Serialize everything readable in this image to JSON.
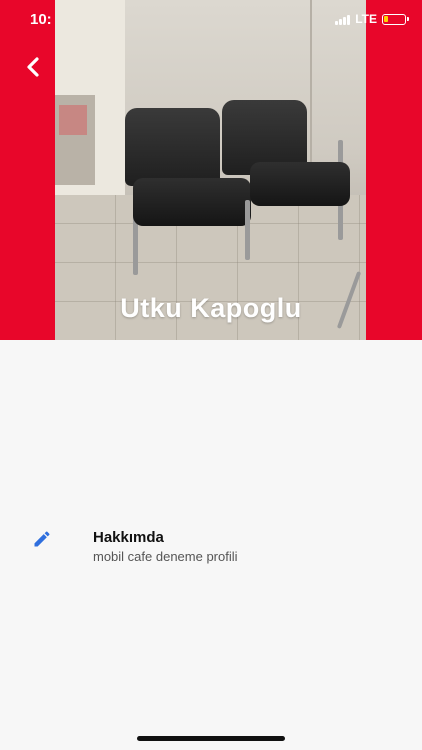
{
  "status_bar": {
    "time": "10:",
    "network": "LTE"
  },
  "header": {
    "back_icon": "chevron-left-icon",
    "name": "Utku Kapoglu",
    "background_color": "#e8062a"
  },
  "about": {
    "icon": "pencil-icon",
    "title": "Hakkımda",
    "subtitle": "mobil cafe deneme profili",
    "icon_color": "#2f6fde"
  }
}
